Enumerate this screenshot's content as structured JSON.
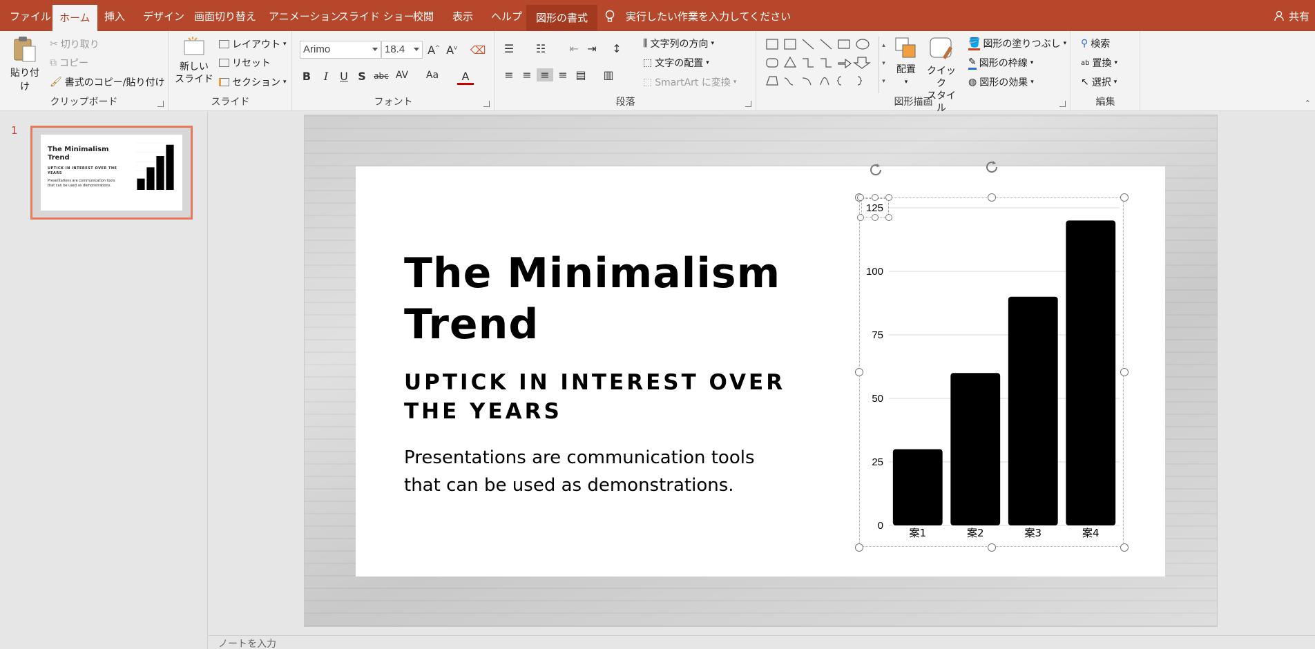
{
  "tabs": [
    "ファイル",
    "ホーム",
    "挿入",
    "デザイン",
    "画面切り替え",
    "アニメーション",
    "スライド ショー",
    "校閲",
    "表示",
    "ヘルプ",
    "図形の書式"
  ],
  "tell_me": "実行したい作業を入力してください",
  "share": "共有",
  "clipboard": {
    "paste": "貼り付け",
    "cut": "切り取り",
    "copy": "コピー",
    "format_painter": "書式のコピー/貼り付け",
    "label": "クリップボード"
  },
  "slides_group": {
    "new_slide_1": "新しい",
    "new_slide_2": "スライド",
    "layout": "レイアウト",
    "reset": "リセット",
    "section": "セクション",
    "label": "スライド"
  },
  "font": {
    "name": "Arimo",
    "size": "18.4",
    "label": "フォント"
  },
  "paragraph": {
    "text_direction": "文字列の方向",
    "align_text": "文字の配置",
    "smartart": "SmartArt に変換",
    "label": "段落"
  },
  "drawing": {
    "arrange": "配置",
    "quick_1": "クイック",
    "quick_2": "スタイル",
    "fill": "図形の塗りつぶし",
    "outline": "図形の枠線",
    "effects": "図形の効果",
    "label": "図形描画"
  },
  "editing": {
    "find": "検索",
    "replace": "置換",
    "select": "選択",
    "label": "編集"
  },
  "thumb_number": "1",
  "slide": {
    "title": "The Minimalism Trend",
    "subtitle": "UPTICK IN INTEREST OVER THE YEARS",
    "body": "Presentations are communication tools that can be used as demonstrations."
  },
  "notes_placeholder": "ノートを入力",
  "chart_data": {
    "type": "bar",
    "categories": [
      "案1",
      "案2",
      "案3",
      "案4"
    ],
    "values": [
      30,
      60,
      90,
      120
    ],
    "ylim": [
      0,
      125
    ],
    "yticks": [
      0,
      25,
      50,
      75,
      100,
      125
    ],
    "grid": true,
    "color": "#000000"
  }
}
